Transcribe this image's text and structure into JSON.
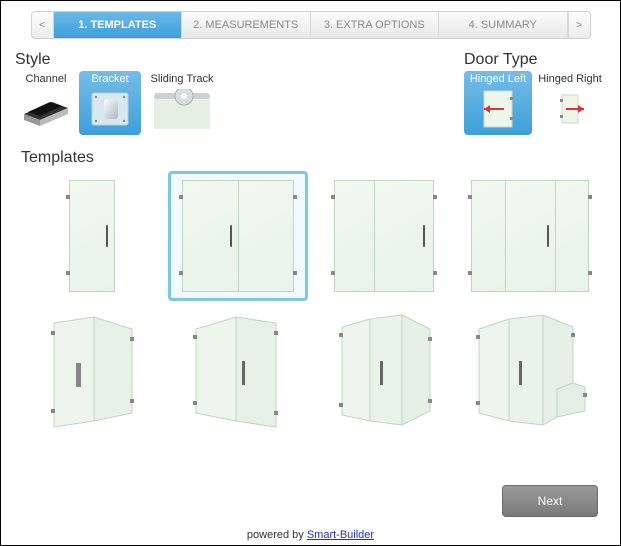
{
  "steps": {
    "prev": "<",
    "next": ">",
    "items": [
      "1. TEMPLATES",
      "2. MEASUREMENTS",
      "3. EXTRA OPTIONS",
      "4. SUMMARY"
    ]
  },
  "style": {
    "title": "Style",
    "options": [
      {
        "label": "Channel"
      },
      {
        "label": "Bracket"
      },
      {
        "label": "Sliding Track"
      }
    ]
  },
  "doorType": {
    "title": "Door Type",
    "options": [
      {
        "label": "Hinged Left"
      },
      {
        "label": "Hinged Right"
      }
    ]
  },
  "templates": {
    "title": "Templates"
  },
  "buttons": {
    "next": "Next"
  },
  "footer": {
    "prefix": "powered by ",
    "link": "Smart-Builder"
  }
}
